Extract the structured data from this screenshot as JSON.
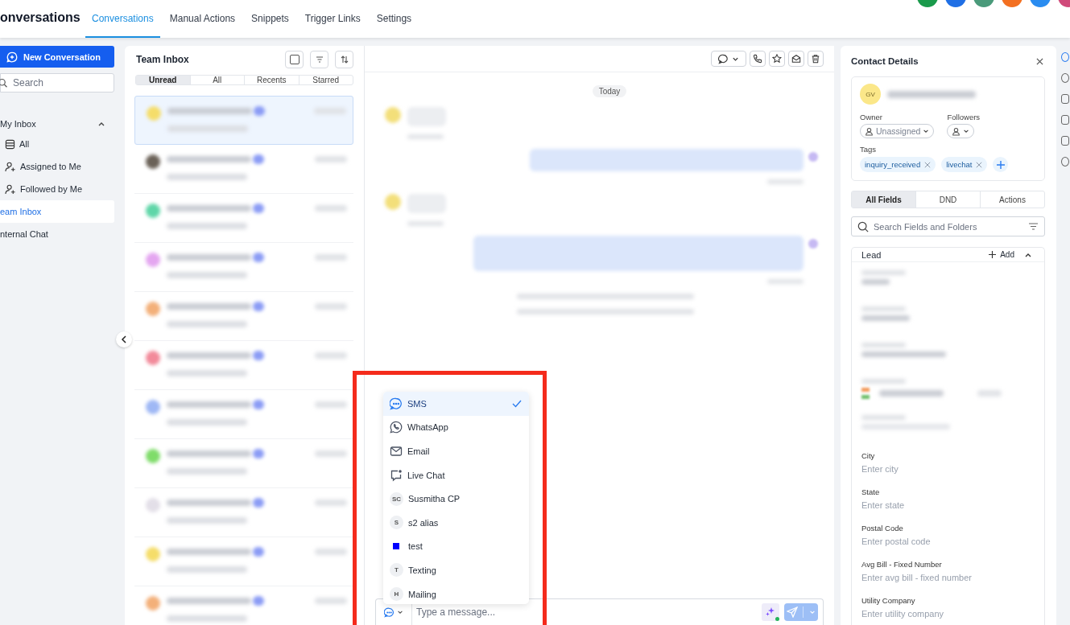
{
  "header": {
    "title": "onversations",
    "tabs": [
      {
        "label": "Conversations",
        "selected": true
      },
      {
        "label": "Manual Actions",
        "selected": false
      },
      {
        "label": "Snippets",
        "selected": false
      },
      {
        "label": "Trigger Links",
        "selected": false
      },
      {
        "label": "Settings",
        "selected": false
      }
    ],
    "apps": [
      {
        "color": "#1a9a4b"
      },
      {
        "color": "#1f6fe5"
      },
      {
        "color": "#4a9a7a"
      },
      {
        "color": "#f37021"
      },
      {
        "color": "#2a8cf0"
      },
      {
        "color": "#d04a7a"
      }
    ]
  },
  "sidebar": {
    "new_button": "New Conversation",
    "search": {
      "placeholder": "Search"
    },
    "section": {
      "label": "My Inbox",
      "expanded": true,
      "items": [
        {
          "kind": "all",
          "label": "All",
          "selected": false
        },
        {
          "kind": "person",
          "label": "Assigned to Me",
          "selected": false
        },
        {
          "kind": "person",
          "label": "Followed by Me",
          "selected": false
        }
      ]
    },
    "items": [
      {
        "label": "eam Inbox",
        "selected": true
      },
      {
        "label": "nternal Chat",
        "selected": false
      }
    ]
  },
  "inbox": {
    "title": "Team Inbox",
    "select_all": {
      "checked": false
    },
    "filters": [
      {
        "label": "Unread",
        "selected": true
      },
      {
        "label": "All",
        "selected": false
      },
      {
        "label": "Recents",
        "selected": false
      },
      {
        "label": "Starred",
        "selected": false
      }
    ],
    "conversations": [
      {
        "color": "#f5dd6a",
        "selected": true
      },
      {
        "color": "#6b6258",
        "selected": false
      },
      {
        "color": "#5fd6a8",
        "selected": false
      },
      {
        "color": "#e4a6f0",
        "selected": false
      },
      {
        "color": "#f3b07a",
        "selected": false
      },
      {
        "color": "#f28a9a",
        "selected": false
      },
      {
        "color": "#9fb8f5",
        "selected": false
      },
      {
        "color": "#7fdc6a",
        "selected": false
      },
      {
        "color": "#e3dfe8",
        "selected": false
      },
      {
        "color": "#f5dd6a",
        "selected": false
      },
      {
        "color": "#f3b07a",
        "selected": false
      }
    ]
  },
  "chat": {
    "date": "Today",
    "messages": [
      {
        "kind": "in"
      },
      {
        "kind": "out"
      },
      {
        "kind": "in"
      },
      {
        "kind": "out_long"
      },
      {
        "kind": "event"
      },
      {
        "kind": "event"
      }
    ],
    "channels": [
      {
        "kind": "sms",
        "label": "SMS",
        "selected": true
      },
      {
        "kind": "whatsapp",
        "label": "WhatsApp",
        "selected": false
      },
      {
        "kind": "email",
        "label": "Email",
        "selected": false
      },
      {
        "kind": "livechat",
        "label": "Live Chat",
        "selected": false
      },
      {
        "kind": "initials",
        "initials": "SC",
        "label": "Susmitha CP",
        "selected": false
      },
      {
        "kind": "initials",
        "initials": "S",
        "label": "s2 alias",
        "selected": false
      },
      {
        "kind": "square",
        "color": "#0000ff",
        "label": "test",
        "selected": false
      },
      {
        "kind": "initials",
        "initials": "T",
        "label": "Texting",
        "selected": false
      },
      {
        "kind": "initials",
        "initials": "H",
        "label": "Mailing",
        "selected": false
      }
    ],
    "composer": {
      "placeholder": "Type a message..."
    }
  },
  "contact": {
    "title": "Contact Details",
    "initials": "GV",
    "owner_label": "Owner",
    "owner": "Unassigned",
    "followers_label": "Followers",
    "tags_label": "Tags",
    "tags": [
      "inquiry_received",
      "livechat"
    ],
    "tabs": [
      {
        "label": "All Fields",
        "selected": true
      },
      {
        "label": "DND",
        "selected": false
      },
      {
        "label": "Actions",
        "selected": false
      }
    ],
    "search": {
      "placeholder": "Search Fields and Folders"
    },
    "section": {
      "label": "Lead",
      "add": "Add",
      "expanded": true
    },
    "fields": [
      {
        "kind": "hidden"
      },
      {
        "kind": "hidden"
      },
      {
        "kind": "hidden"
      },
      {
        "kind": "hidden_phone"
      },
      {
        "kind": "hidden"
      },
      {
        "kind": "text",
        "label": "City",
        "placeholder": "Enter city"
      },
      {
        "kind": "text",
        "label": "State",
        "placeholder": "Enter state"
      },
      {
        "kind": "text",
        "label": "Postal Code",
        "placeholder": "Enter postal code"
      },
      {
        "kind": "text",
        "label": "Avg Bill - Fixed Number",
        "placeholder": "Enter avg bill - fixed number"
      },
      {
        "kind": "text",
        "label": "Utility Company",
        "placeholder": "Enter utility company"
      }
    ]
  }
}
